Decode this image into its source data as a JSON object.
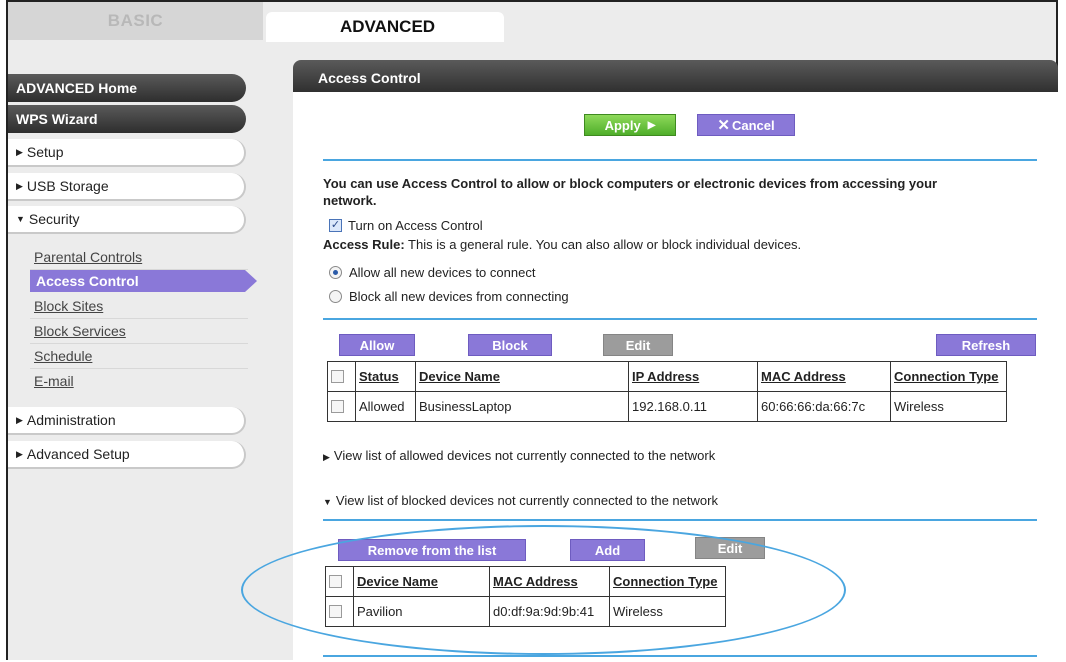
{
  "tabs": {
    "basic": "BASIC",
    "advanced": "ADVANCED"
  },
  "sidebar": {
    "advanced_home": "ADVANCED Home",
    "wps_wizard": "WPS Wizard",
    "setup": "Setup",
    "usb_storage": "USB Storage",
    "security": "Security",
    "security_items": [
      "Parental Controls",
      "Access Control",
      "Block Sites",
      "Block Services",
      "Schedule",
      "E-mail"
    ],
    "administration": "Administration",
    "advanced_setup": "Advanced Setup"
  },
  "panel": {
    "title": "Access Control",
    "apply": "Apply",
    "cancel": "Cancel",
    "intro_line1": "You can use Access Control to allow or block computers or electronic devices from accessing your",
    "intro_line2": "network.",
    "turn_on_label": "Turn on Access Control",
    "turn_on_checked": true,
    "access_rule_label": "Access Rule:",
    "access_rule_text": "This is a general rule. You can also allow or block individual devices.",
    "radio_allow": "Allow all new devices to connect",
    "radio_block": "Block all new devices from connecting",
    "selected_rule": "allow"
  },
  "connected_table": {
    "buttons": {
      "allow": "Allow",
      "block": "Block",
      "edit": "Edit",
      "refresh": "Refresh"
    },
    "headers": [
      "Status",
      "Device Name",
      "IP Address",
      "MAC Address",
      "Connection Type"
    ],
    "rows": [
      {
        "status": "Allowed",
        "device_name": "BusinessLaptop",
        "ip": "192.168.0.11",
        "mac": "60:66:66:da:66:7c",
        "conn_type": "Wireless"
      }
    ]
  },
  "view_allowed_link": "View list of allowed devices not currently connected to the network",
  "view_blocked_link": "View list of blocked devices not currently connected to the network",
  "blocked_table": {
    "buttons": {
      "remove": "Remove from the list",
      "add": "Add",
      "edit": "Edit"
    },
    "headers": [
      "Device Name",
      "MAC Address",
      "Connection Type"
    ],
    "rows": [
      {
        "device_name": "Pavilion",
        "mac": "d0:df:9a:9d:9b:41",
        "conn_type": "Wireless"
      }
    ]
  },
  "colors": {
    "accent_purple": "#8a78d8",
    "accent_blue": "#4aa6e0",
    "apply_green": "#5cb82e",
    "allowed_green": "#2e9a2e"
  }
}
